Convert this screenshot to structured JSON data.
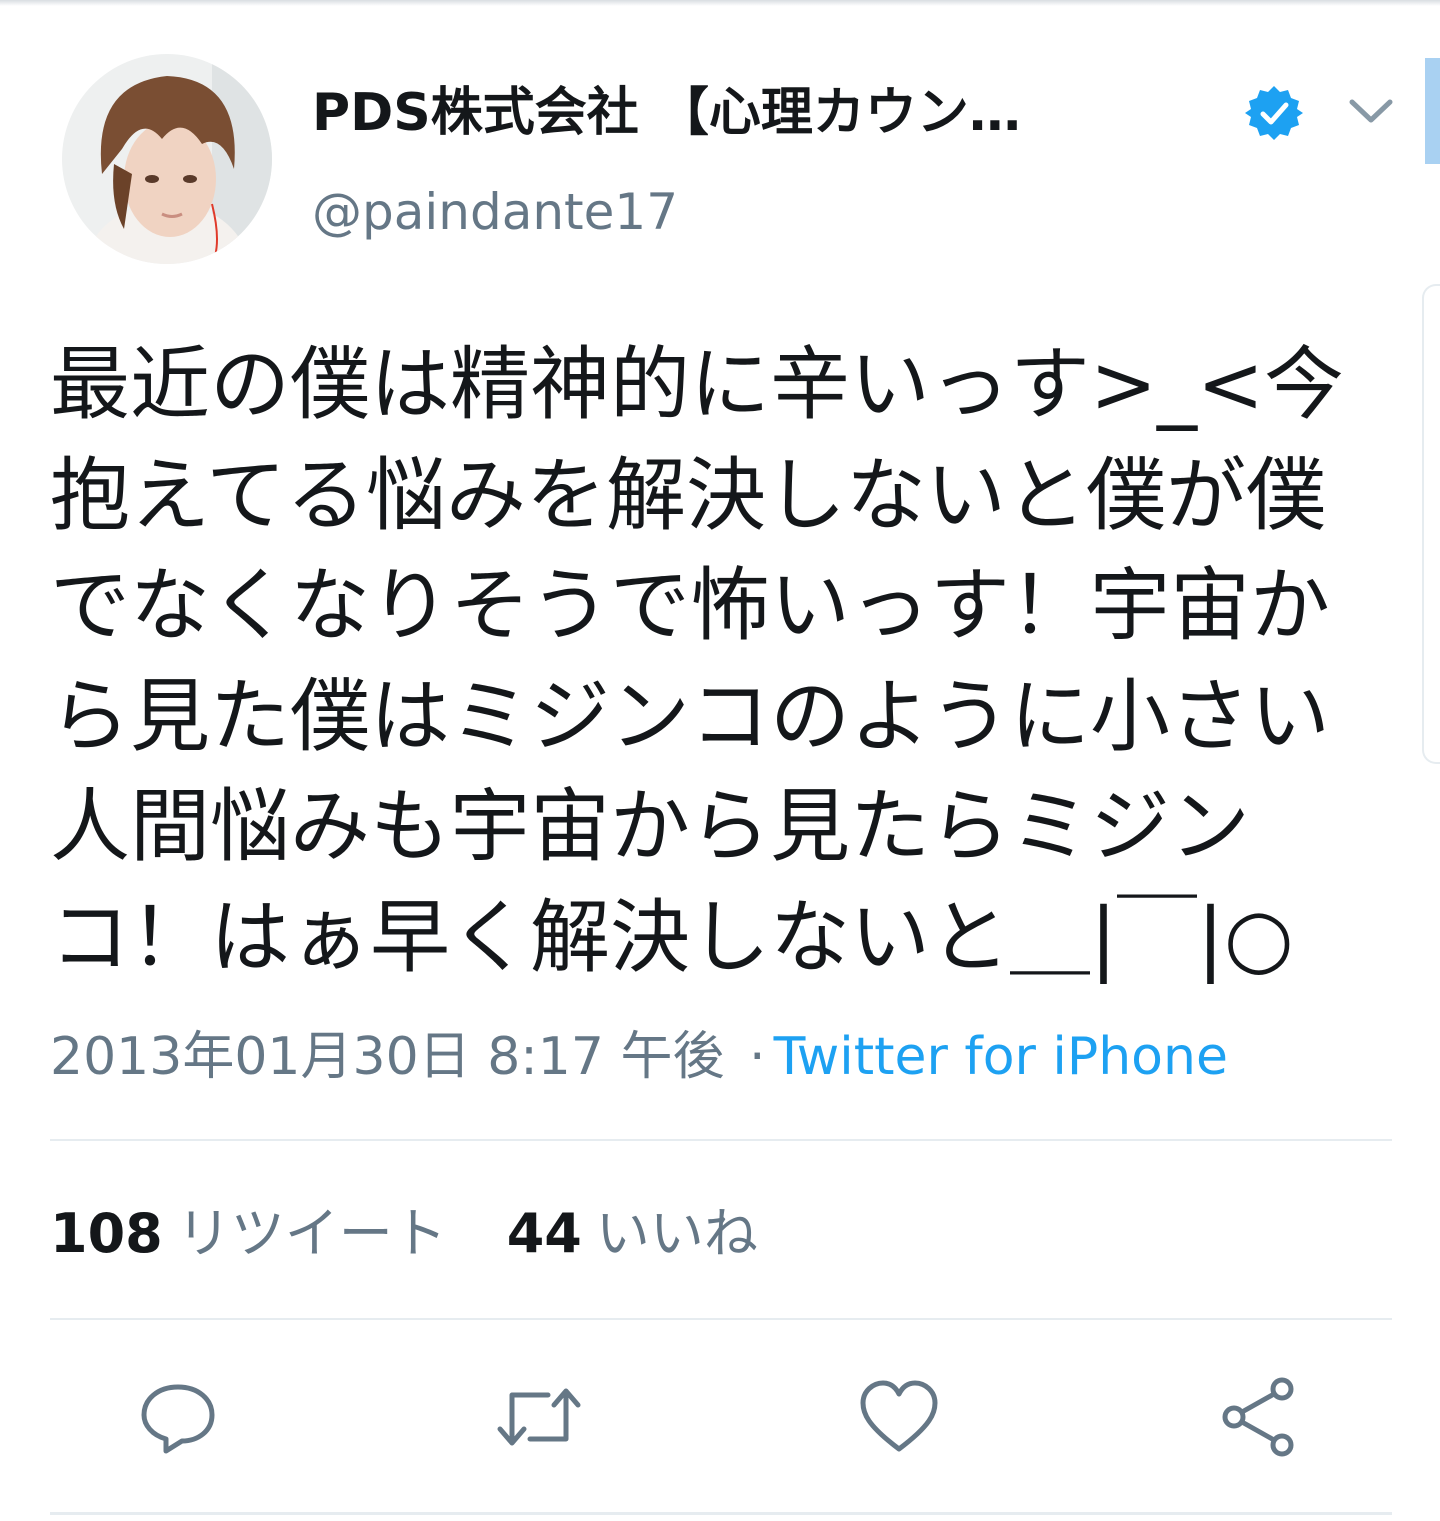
{
  "user": {
    "display_name": "PDS株式会社 【心理カウン…",
    "handle": "@paindante17",
    "verified": true,
    "verified_color": "#1da1f2"
  },
  "tweet": {
    "lines": [
      "最近の僕は精神的に辛いっす>_<今",
      "抱えてる悩みを解決しないと僕が僕",
      "でなくなりそうで怖いっす！宇宙か",
      "ら見た僕はミジンコのように小さい",
      "人間悩みも宇宙から見たらミジン",
      "コ！はぁ早く解決しないと＿|￣|○"
    ]
  },
  "meta": {
    "timestamp": "2013年01月30日 8:17 午後",
    "separator": "·",
    "source": "Twitter for iPhone"
  },
  "stats": {
    "retweet_count": "108",
    "retweet_label": "リツイート",
    "like_count": "44",
    "like_label": "いいね"
  },
  "actions": [
    "reply-icon",
    "retweet-icon",
    "like-icon",
    "share-icon"
  ],
  "colors": {
    "text": "#14171a",
    "secondary": "#657786",
    "link": "#1da1f2",
    "divider": "#e6ecf0"
  }
}
